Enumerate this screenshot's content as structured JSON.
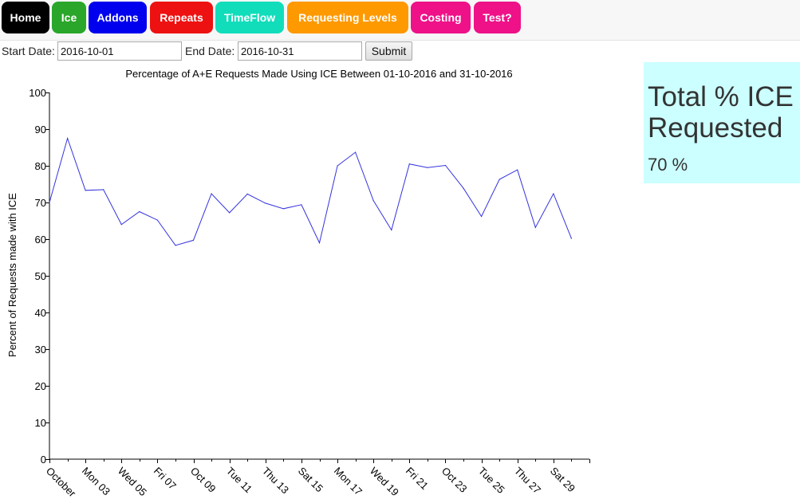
{
  "nav": {
    "items": [
      {
        "label": "Home",
        "color": "#000000"
      },
      {
        "label": "Ice",
        "color": "#2aa62a"
      },
      {
        "label": "Addons",
        "color": "#0000ee"
      },
      {
        "label": "Repeats",
        "color": "#ee1111"
      },
      {
        "label": "TimeFlow",
        "color": "#11ddbb"
      },
      {
        "label": "Requesting Levels",
        "color": "#ff9900"
      },
      {
        "label": "Costing",
        "color": "#ee1188"
      },
      {
        "label": "Test?",
        "color": "#ee1188"
      }
    ]
  },
  "form": {
    "start_label": "Start Date:",
    "start_value": "2016-10-01",
    "end_label": "End Date:",
    "end_value": "2016-10-31",
    "submit_label": "Submit"
  },
  "stat": {
    "title_line1": "Total % ICE",
    "title_line2": "Requested",
    "value": "70 %",
    "background": "#ccffff"
  },
  "chart_data": {
    "type": "line",
    "title": "Percentage of A+E Requests Made Using ICE Between 01-10-2016 and 31-10-2016",
    "xlabel": "",
    "ylabel": "Percent of Requests made with ICE",
    "ylim": [
      0,
      100
    ],
    "yticks": [
      0,
      10,
      20,
      30,
      40,
      50,
      60,
      70,
      80,
      90,
      100
    ],
    "x": [
      "2016-10-01",
      "2016-10-02",
      "2016-10-03",
      "2016-10-04",
      "2016-10-05",
      "2016-10-06",
      "2016-10-07",
      "2016-10-08",
      "2016-10-09",
      "2016-10-10",
      "2016-10-11",
      "2016-10-12",
      "2016-10-13",
      "2016-10-14",
      "2016-10-15",
      "2016-10-16",
      "2016-10-17",
      "2016-10-18",
      "2016-10-19",
      "2016-10-20",
      "2016-10-21",
      "2016-10-22",
      "2016-10-23",
      "2016-10-24",
      "2016-10-25",
      "2016-10-26",
      "2016-10-27",
      "2016-10-28",
      "2016-10-29",
      "2016-10-30",
      "2016-10-31"
    ],
    "xtick_labels": [
      "October",
      "Mon 03",
      "Wed 05",
      "Fri 07",
      "Oct 09",
      "Tue 11",
      "Thu 13",
      "Sat 15",
      "Mon 17",
      "Wed 19",
      "Fri 21",
      "Oct 23",
      "Tue 25",
      "Thu 27",
      "Sat 29"
    ],
    "series": [
      {
        "color": "#3333dd",
        "values": [
          70,
          87.5,
          73.3,
          73.5,
          64,
          67.5,
          65.2,
          58.3,
          59.7,
          72.4,
          67.2,
          72.3,
          69.8,
          68.3,
          69.4,
          59,
          80,
          83.7,
          70.5,
          62.5,
          80.5,
          79.5,
          80.1,
          73.9,
          66.2,
          76.3,
          78.9,
          63.2,
          72.4,
          60.2
        ]
      }
    ],
    "grid": false,
    "legend": "none"
  }
}
